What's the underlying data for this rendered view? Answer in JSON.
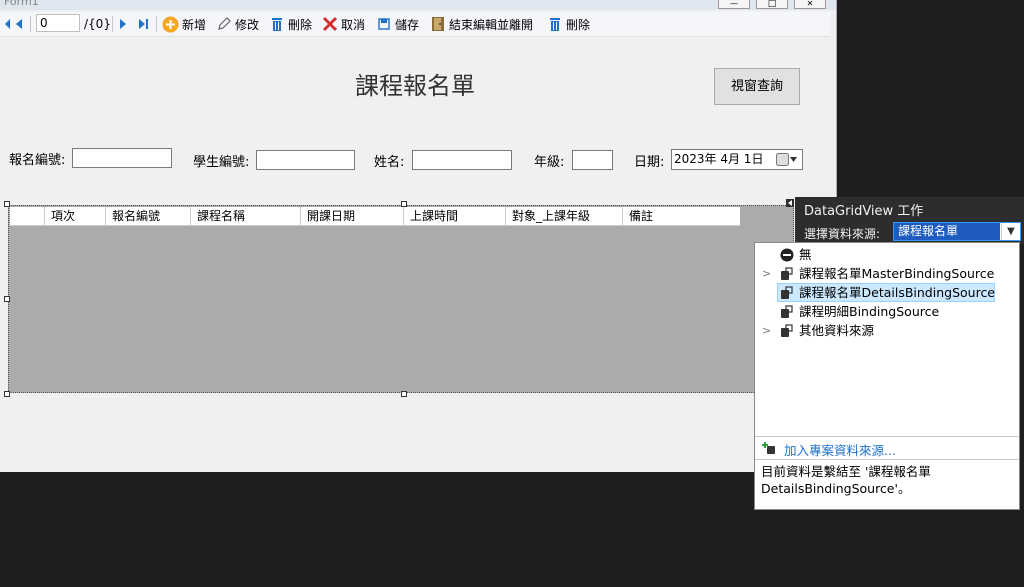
{
  "window": {
    "title": "Form1",
    "minimize_glyph": "—",
    "maximize_glyph": "□",
    "close_glyph": "✕"
  },
  "toolbar": {
    "position_value": "0",
    "count_label": "/{0}",
    "add_label": "新增",
    "edit_label": "修改",
    "delete_label": "刪除",
    "cancel_label": "取消",
    "save_label": "儲存",
    "end_edit_label": "結束編輯並離開",
    "delete2_label": "刪除"
  },
  "form": {
    "heading": "課程報名單",
    "query_button": "視窗查詢",
    "fields": {
      "enroll_no_label": "報名編號:",
      "student_no_label": "學生編號:",
      "name_label": "姓名:",
      "grade_label": "年級:",
      "date_label": "日期:",
      "date_value": "2023年  4月  1日"
    }
  },
  "grid": {
    "columns": [
      "項次",
      "報名編號",
      "課程名稱",
      "開課日期",
      "上課時間",
      "對象_上課年級",
      "備註"
    ]
  },
  "tasks_panel": {
    "title": "DataGridView 工作",
    "source_label": "選擇資料來源:",
    "source_value": "課程報名單"
  },
  "source_dropdown": {
    "items": [
      {
        "label": "無",
        "icon": "none-circle-icon",
        "expandable": false,
        "selected": false
      },
      {
        "label": "課程報名單MasterBindingSource",
        "icon": "binding-source-icon",
        "expandable": true,
        "selected": false
      },
      {
        "label": "課程報名單DetailsBindingSource",
        "icon": "binding-source-icon",
        "expandable": false,
        "selected": true
      },
      {
        "label": "課程明細BindingSource",
        "icon": "binding-source-icon",
        "expandable": false,
        "selected": false
      },
      {
        "label": "其他資料來源",
        "icon": "binding-source-icon",
        "expandable": true,
        "selected": false
      }
    ],
    "add_link": "加入專案資料來源...",
    "bound_text": "目前資料是繫結至 '課程報名單 DetailsBindingSource'。"
  },
  "colors": {
    "selection_blue": "#1f5cbf",
    "link_blue": "#1e72c8",
    "grid_gray": "#ababab",
    "dark_bg": "#1e1e1e"
  }
}
